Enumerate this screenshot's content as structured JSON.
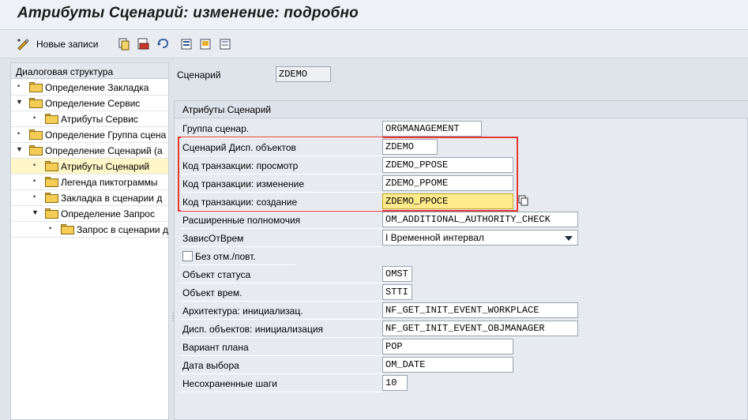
{
  "window": {
    "title": "Атрибуты Сценарий: изменение: подробно"
  },
  "toolbar": {
    "new_entries_label": "Новые записи"
  },
  "nav": {
    "header": "Диалоговая структура",
    "items": [
      {
        "label": "Определение Закладка",
        "expander": "•"
      },
      {
        "label": "Определение Сервис",
        "expander": "▼"
      },
      {
        "label": "Атрибуты Сервис",
        "expander": "•"
      },
      {
        "label": "Определение Группа сцена",
        "expander": "•"
      },
      {
        "label": "Определение Сценарий (а",
        "expander": "▼"
      },
      {
        "label": "Атрибуты Сценарий",
        "expander": "•"
      },
      {
        "label": "Легенда пиктограммы",
        "expander": "•"
      },
      {
        "label": "Закладка в сценарии д",
        "expander": "•"
      },
      {
        "label": "Определение Запрос",
        "expander": "▼"
      },
      {
        "label": "Запрос в сценарии д",
        "expander": "•"
      }
    ]
  },
  "header_field": {
    "label": "Сценарий",
    "value": "ZDEMO"
  },
  "group": {
    "title": "Атрибуты Сценарий",
    "rows": [
      {
        "label": "Группа сценар.",
        "value": "ORGMANAGEMENT"
      },
      {
        "label": "Сценарий Дисп. объектов",
        "value": "ZDEMO"
      },
      {
        "label": "Код транзакции: просмотр",
        "value": "ZDEMO_PPOSE"
      },
      {
        "label": "Код транзакции: изменение",
        "value": "ZDEMO_PPOME"
      },
      {
        "label": "Код транзакции: создание",
        "value": "ZDEMO_PPOCE"
      },
      {
        "label": "Расширенные полномочия",
        "value": "OM_ADDITIONAL_AUTHORITY_CHECK"
      },
      {
        "label": "ЗависОтВрем",
        "value": "I Временной интервал"
      },
      {
        "label": "Без отм./повт.",
        "value": ""
      },
      {
        "label": "Объект статуса",
        "value": "OMST"
      },
      {
        "label": "Объект врем.",
        "value": "STTI"
      },
      {
        "label": "Архитектура: инициализац.",
        "value": "NF_GET_INIT_EVENT_WORKPLACE"
      },
      {
        "label": "Дисп. объектов: инициализация",
        "value": "NF_GET_INIT_EVENT_OBJMANAGER"
      },
      {
        "label": "Вариант плана",
        "value": "POP"
      },
      {
        "label": "Дата выбора",
        "value": "OM_DATE"
      },
      {
        "label": "Несохраненные шаги",
        "value": "10"
      }
    ]
  },
  "colors": {
    "highlight_border": "#e53935",
    "focus_field": "#ffeb8c",
    "selected_row": "#fff7c8"
  }
}
